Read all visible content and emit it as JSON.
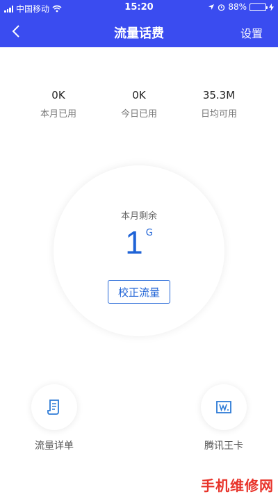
{
  "status_bar": {
    "carrier": "中国移动",
    "time": "15:20",
    "battery_percent": "88%",
    "battery_level": 0.88
  },
  "nav": {
    "title": "流量话费",
    "settings_label": "设置"
  },
  "stats": [
    {
      "value": "0K",
      "label": "本月已用"
    },
    {
      "value": "0K",
      "label": "今日已用"
    },
    {
      "value": "35.3M",
      "label": "日均可用"
    }
  ],
  "remaining": {
    "label": "本月剩余",
    "value": "1",
    "unit": "G",
    "calibrate_label": "校正流量"
  },
  "features": [
    {
      "label": "流量详单",
      "icon": "bill-detail-icon"
    },
    {
      "label": "腾讯王卡",
      "icon": "tencent-card-icon"
    }
  ],
  "watermark": "手机维修网",
  "colors": {
    "nav_bg": "#3A4CF0",
    "accent": "#1F63D6",
    "battery": "#4CD964",
    "watermark": "#E8332A"
  }
}
